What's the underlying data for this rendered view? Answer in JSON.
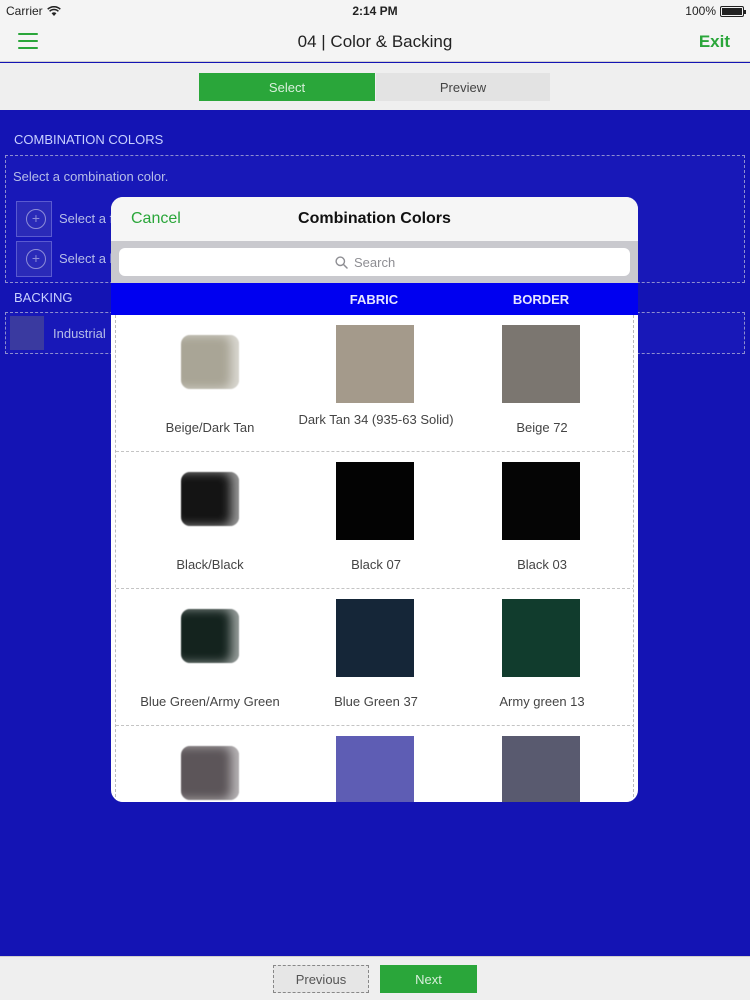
{
  "status_bar": {
    "carrier": "Carrier",
    "time": "2:14 PM",
    "battery": "100%",
    "battery_level": 1.0
  },
  "nav": {
    "title": "04 | Color & Backing",
    "exit_label": "Exit"
  },
  "segments": {
    "select_label": "Select",
    "preview_label": "Preview"
  },
  "form": {
    "combination_header": "COMBINATION COLORS",
    "combination_hint": "Select a combination color.",
    "combo_rows": [
      {
        "label": "Select a f"
      },
      {
        "label": "Select a b"
      }
    ],
    "backing_header": "BACKING",
    "backing_item_label": "Industrial"
  },
  "footer": {
    "previous_label": "Previous",
    "next_label": "Next"
  },
  "modal": {
    "cancel_label": "Cancel",
    "title": "Combination Colors",
    "search_placeholder": "Search",
    "col_fabric": "FABRIC",
    "col_border": "BORDER",
    "rows": [
      {
        "combo_name": "Beige/Dark Tan",
        "combo_color": "#a9a596",
        "fabric_name": "Dark Tan 34 (935-63 Solid)",
        "fabric_color": "#a49a8b",
        "border_name": "Beige 72",
        "border_color": "#7b7670"
      },
      {
        "combo_name": "Black/Black",
        "combo_color": "#141414",
        "fabric_name": "Black 07",
        "fabric_color": "#030303",
        "border_name": "Black 03",
        "border_color": "#050505"
      },
      {
        "combo_name": "Blue Green/Army Green",
        "combo_color": "#14231e",
        "fabric_name": "Blue Green 37",
        "fabric_color": "#152638",
        "border_name": "Army green 13",
        "border_color": "#113c2d"
      },
      {
        "combo_name": "",
        "combo_color": "#5c5559",
        "fabric_name": "",
        "fabric_color": "#5e5db4",
        "border_name": "",
        "border_color": "#595a6f"
      }
    ]
  }
}
